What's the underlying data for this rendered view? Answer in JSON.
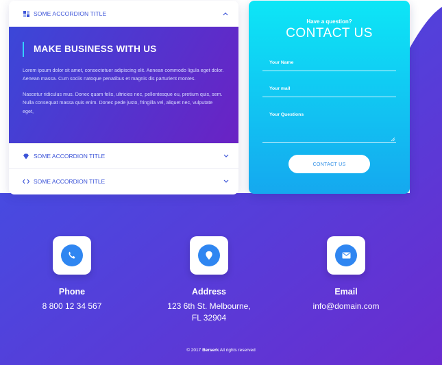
{
  "accordion": {
    "item1_title": "SOME ACCORDION TITLE",
    "body_heading": "MAKE BUSINESS WITH US",
    "body_p1": "Lorem ipsum dolor sit amet, consectetuer adipiscing elit. Aenean commodo ligula eget dolor. Aenean massa. Cum sociis natoque penatibus et magnis dis parturient montes.",
    "body_p2": "Nascetur ridiculus mus. Donec quam felis, ultricies nec, pellentesque eu, pretium quis, sem. Nulla consequat massa quis enim. Donec pede justo, fringilla vel, aliquet nec, vulputate eget,",
    "item2_title": "SOME ACCORDION TITLE",
    "item3_title": "SOME ACCORDION TITLE"
  },
  "contact": {
    "question": "Have a question?",
    "title": "CONTACT US",
    "name_label": "Your Name",
    "mail_label": "Your mail",
    "questions_label": "Your Questions",
    "button": "CONTACT US"
  },
  "info": {
    "phone_title": "Phone",
    "phone_value": "8 800 12 34 567",
    "address_title": "Address",
    "address_line1": "123 6th St. Melbourne,",
    "address_line2": "FL 32904",
    "email_title": "Email",
    "email_value": "info@domain.com"
  },
  "footer": {
    "prefix": "© 2017",
    "brand": "Berserk",
    "suffix": "All rights reserved"
  },
  "colors": {
    "accent": "#3d55d8",
    "contact_top": "#0de6f6",
    "contact_bottom": "#15a8ef",
    "bg_start": "#3b55e6",
    "bg_end": "#6a2ccf"
  }
}
